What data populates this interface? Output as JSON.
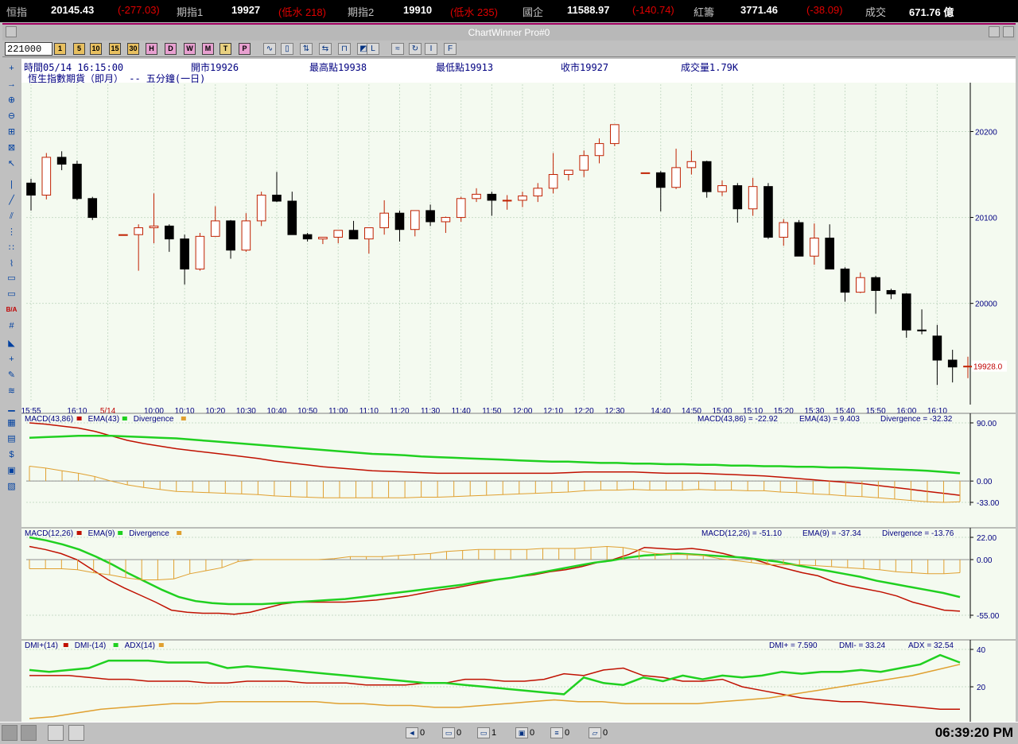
{
  "ticker": [
    {
      "label": "恒指",
      "value": "20145.43",
      "change": "(-277.03)"
    },
    {
      "label": "期指1",
      "value": "19927",
      "change": "(低水 218)"
    },
    {
      "label": "期指2",
      "value": "19910",
      "change": "(低水 235)"
    },
    {
      "label": "國企",
      "value": "11588.97",
      "change": "(-140.74)"
    },
    {
      "label": "紅籌",
      "value": "3771.46",
      "change": "(-38.09)"
    },
    {
      "label": "成交",
      "value": "671.76 億",
      "change": ""
    }
  ],
  "window": {
    "title": "ChartWinner Pro#0"
  },
  "toolbar": {
    "code": "221000",
    "period_buttons": [
      "1",
      "5",
      "10",
      "15",
      "30",
      "H",
      "D",
      "W",
      "M",
      "T",
      "P"
    ],
    "period_colors": [
      "#e8c060",
      "#e8c060",
      "#e8c060",
      "#e8c060",
      "#e8c060",
      "#e8a0d0",
      "#e8a0d0",
      "#e8a0d0",
      "#e8a0d0",
      "#e8d080",
      "#e8a0d0"
    ],
    "tool_icons": [
      "line-chart-icon",
      "candlestick-icon",
      "bar-chart-icon",
      "compare-icon",
      "chart-type-icon",
      "chart-type2-icon",
      "label-icon",
      "overlay-icon",
      "refresh-icon",
      "info-icon",
      "function-icon"
    ],
    "tool_glyphs": [
      "∿",
      "▯",
      "⇅",
      "⇆",
      "⊓",
      "◩",
      "L",
      "≈",
      "↻",
      "I",
      "F"
    ]
  },
  "left_tools": [
    "crosshair-icon",
    "arrow-icon",
    "zoom-in-icon",
    "zoom-out-icon",
    "zoom-area-icon",
    "zoom-fit-icon",
    "pointer-icon",
    "vertical-line-icon",
    "trend-line-icon",
    "parallel-line-icon",
    "fibonacci-icon",
    "pattern-icon",
    "speed-line-icon",
    "box-icon",
    "box2-icon",
    "bid-ask-icon",
    "grid-icon",
    "fill-icon",
    "plus-icon",
    "pen-icon",
    "wave-icon",
    "text-icon",
    "calc-icon",
    "note-icon",
    "scroll-icon",
    "layout-icon",
    "clipboard-icon"
  ],
  "left_glyphs": [
    "+",
    "→",
    "⊕",
    "⊖",
    "⊞",
    "⊠",
    "↖",
    "|",
    "╱",
    "⫽",
    "⋮",
    "∷",
    "⌇",
    "▭",
    "▭",
    "B/A",
    "#",
    "◣",
    "+",
    "✎",
    "≋",
    "▁",
    "▦",
    "▤",
    "$",
    "▣",
    "▧"
  ],
  "info": {
    "time": "時間05/14 16:15:00",
    "open": "開市19926",
    "high": "最高點19938",
    "low": "最低點19913",
    "close": "收市19927",
    "volume": "成交量1.79K",
    "subtitle": "恆生指數期貨（即月） -- 五分鐘(一日)"
  },
  "colors": {
    "up": "#c02000",
    "down": "#000000",
    "red": "#c01000",
    "green": "#20d020",
    "orange": "#e0a030",
    "grid": "#c8dcc8",
    "axis": "#000080"
  },
  "chart_data": [
    {
      "type": "candlestick",
      "title": "恆生指數期貨（即月） -- 五分鐘(一日)",
      "ylim": [
        19885,
        20255
      ],
      "y_ticks": [
        20000,
        20100,
        20200
      ],
      "last_price_label": "19928.0",
      "x_tick_labels": [
        "15:55",
        "16:10",
        "5/14",
        "10:00",
        "10:10",
        "10:20",
        "10:30",
        "10:40",
        "10:50",
        "11:00",
        "11:10",
        "11:20",
        "11:30",
        "11:40",
        "11:50",
        "12:00",
        "12:10",
        "12:20",
        "12:30",
        "14:40",
        "14:50",
        "15:00",
        "15:10",
        "15:20",
        "15:30",
        "15:40",
        "15:50",
        "16:00",
        "16:10"
      ],
      "x_tick_index": [
        0,
        3,
        5,
        8,
        10,
        12,
        14,
        16,
        18,
        20,
        22,
        24,
        26,
        28,
        30,
        32,
        34,
        36,
        38,
        41,
        43,
        45,
        47,
        49,
        51,
        53,
        55,
        57,
        59
      ],
      "candles": [
        [
          20140,
          20145,
          20108,
          20126
        ],
        [
          20126,
          20175,
          20121,
          20170
        ],
        [
          20170,
          20177,
          20155,
          20162
        ],
        [
          20162,
          20166,
          20120,
          20122
        ],
        [
          20122,
          20124,
          20097,
          20100
        ],
        [
          null,
          null,
          null,
          null
        ],
        [
          20080,
          20080,
          20080,
          20080
        ],
        [
          20080,
          20092,
          20038,
          20088
        ],
        [
          20088,
          20128,
          20070,
          20090
        ],
        [
          20090,
          20092,
          20060,
          20075
        ],
        [
          20075,
          20080,
          20022,
          20040
        ],
        [
          20040,
          20082,
          20038,
          20078
        ],
        [
          20078,
          20113,
          20078,
          20096
        ],
        [
          20096,
          20097,
          20052,
          20062
        ],
        [
          20062,
          20105,
          20060,
          20096
        ],
        [
          20096,
          20130,
          20090,
          20126
        ],
        [
          20126,
          20153,
          20118,
          20119
        ],
        [
          20119,
          20130,
          20092,
          20080
        ],
        [
          20080,
          20082,
          20072,
          20075
        ],
        [
          20075,
          20076,
          20069,
          20077
        ],
        [
          20077,
          20085,
          20070,
          20085
        ],
        [
          20085,
          20096,
          20075,
          20075
        ],
        [
          20075,
          20078,
          20058,
          20088
        ],
        [
          20088,
          20120,
          20080,
          20105
        ],
        [
          20105,
          20108,
          20072,
          20086
        ],
        [
          20086,
          20108,
          20078,
          20108
        ],
        [
          20108,
          20115,
          20090,
          20095
        ],
        [
          20095,
          20101,
          20082,
          20100
        ],
        [
          20100,
          20124,
          20095,
          20122
        ],
        [
          20122,
          20134,
          20118,
          20127
        ],
        [
          20127,
          20130,
          20102,
          20120
        ],
        [
          20120,
          20126,
          20109,
          20120
        ],
        [
          20120,
          20130,
          20112,
          20125
        ],
        [
          20125,
          20140,
          20118,
          20134
        ],
        [
          20134,
          20175,
          20128,
          20150
        ],
        [
          20150,
          20154,
          20143,
          20155
        ],
        [
          20155,
          20178,
          20147,
          20172
        ],
        [
          20172,
          20192,
          20163,
          20186
        ],
        [
          20186,
          20208,
          20183,
          20208
        ],
        [
          null,
          null,
          null,
          null
        ],
        [
          20152,
          20152,
          20152,
          20152
        ],
        [
          20152,
          20154,
          20107,
          20135
        ],
        [
          20135,
          20180,
          20133,
          20158
        ],
        [
          20158,
          20178,
          20150,
          20165
        ],
        [
          20165,
          20166,
          20123,
          20130
        ],
        [
          20130,
          20143,
          20125,
          20137
        ],
        [
          20137,
          20140,
          20094,
          20110
        ],
        [
          20110,
          20146,
          20102,
          20136
        ],
        [
          20136,
          20140,
          20075,
          20077
        ],
        [
          20077,
          20098,
          20067,
          20094
        ],
        [
          20094,
          20097,
          20055,
          20055
        ],
        [
          20055,
          20093,
          20045,
          20076
        ],
        [
          20076,
          20092,
          20040,
          20040
        ],
        [
          20040,
          20042,
          20002,
          20013
        ],
        [
          20013,
          20036,
          20012,
          20030
        ],
        [
          20030,
          20032,
          19988,
          20015
        ],
        [
          20015,
          20017,
          20005,
          20011
        ],
        [
          20011,
          20012,
          19960,
          19969
        ],
        [
          19969,
          19993,
          19964,
          19968
        ],
        [
          19962,
          19975,
          19905,
          19934
        ],
        [
          19934,
          19946,
          19908,
          19926
        ],
        [
          19926,
          19938,
          19913,
          19927
        ]
      ]
    },
    {
      "type": "line",
      "title": "MACD(43,86)",
      "legend": [
        "MACD(43,86)",
        "EMA(43)",
        "Divergence"
      ],
      "readout": {
        "macd": "MACD(43,86) = -22.92",
        "ema": "EMA(43) = 9.403",
        "div": "Divergence = -32.32"
      },
      "ylim": [
        -33,
        90
      ],
      "y_ticks": [
        "90.00",
        "0.00",
        "-33.00"
      ],
      "series": [
        {
          "name": "MACD(43,86)",
          "values": [
            90,
            88,
            85,
            82,
            77,
            70,
            63,
            58,
            54,
            50,
            47,
            44,
            41,
            38,
            35,
            31,
            28,
            25,
            22,
            20,
            18,
            16,
            15,
            14,
            13,
            12,
            12,
            12,
            12,
            12,
            12,
            12,
            12,
            13,
            14,
            14,
            14,
            14,
            13,
            12,
            12,
            12,
            11,
            10,
            9,
            8,
            6,
            4,
            2,
            0,
            -2,
            -4,
            -7,
            -10,
            -13,
            -16,
            -19,
            -22
          ]
        },
        {
          "name": "EMA(43)",
          "values": [
            67,
            68,
            69,
            70,
            70,
            70,
            69,
            68,
            67,
            66,
            64,
            62,
            60,
            58,
            56,
            54,
            52,
            50,
            48,
            46,
            44,
            42,
            41,
            40,
            38,
            37,
            36,
            35,
            34,
            33,
            32,
            31,
            30,
            30,
            29,
            28,
            28,
            27,
            27,
            26,
            26,
            25,
            25,
            24,
            24,
            23,
            23,
            22,
            22,
            21,
            21,
            20,
            19,
            18,
            17,
            16,
            14,
            12
          ]
        },
        {
          "name": "Divergence",
          "values": [
            23,
            20,
            16,
            12,
            7,
            0,
            -6,
            -10,
            -13,
            -16,
            -17,
            -18,
            -19,
            -20,
            -21,
            -23,
            -24,
            -25,
            -26,
            -26,
            -26,
            -26,
            -26,
            -26,
            -25,
            -25,
            -24,
            -23,
            -22,
            -21,
            -20,
            -19,
            -18,
            -17,
            -15,
            -14,
            -14,
            -13,
            -14,
            -14,
            -14,
            -13,
            -14,
            -14,
            -15,
            -15,
            -17,
            -18,
            -20,
            -21,
            -23,
            -24,
            -26,
            -28,
            -30,
            -32,
            -33,
            -32
          ]
        }
      ]
    },
    {
      "type": "line",
      "title": "MACD(12,26)",
      "legend": [
        "MACD(12,26)",
        "EMA(9)",
        "Divergence"
      ],
      "readout": {
        "macd": "MACD(12,26) = -51.10",
        "ema": "EMA(9) = -37.34",
        "div": "Divergence = -13.76"
      },
      "ylim": [
        -55,
        22
      ],
      "y_ticks": [
        "22.00",
        "0.00",
        "-55.00"
      ],
      "series": [
        {
          "name": "MACD(12,26)",
          "values": [
            13,
            10,
            6,
            0,
            -10,
            -20,
            -28,
            -35,
            -42,
            -50,
            -52,
            -53,
            -53,
            -54,
            -52,
            -48,
            -44,
            -42,
            -42,
            -42,
            -42,
            -41,
            -40,
            -38,
            -36,
            -33,
            -30,
            -28,
            -25,
            -22,
            -19,
            -17,
            -15,
            -12,
            -10,
            -7,
            -3,
            0,
            5,
            12,
            11,
            10,
            11,
            9,
            6,
            2,
            0,
            -5,
            -9,
            -13,
            -16,
            -22,
            -26,
            -29,
            -32,
            -36,
            -42,
            -46,
            -50,
            -51
          ]
        },
        {
          "name": "EMA(9)",
          "values": [
            22,
            19,
            15,
            10,
            3,
            -5,
            -14,
            -22,
            -30,
            -37,
            -41,
            -43,
            -44,
            -44,
            -44,
            -43,
            -42,
            -41,
            -40,
            -39,
            -37,
            -35,
            -33,
            -31,
            -29,
            -27,
            -25,
            -22,
            -20,
            -18,
            -15,
            -12,
            -9,
            -6,
            -3,
            -1,
            2,
            4,
            5,
            6,
            5,
            4,
            3,
            2,
            0,
            -2,
            -5,
            -8,
            -11,
            -14,
            -17,
            -21,
            -24,
            -27,
            -30,
            -33,
            -37
          ]
        },
        {
          "name": "Divergence",
          "values": [
            -9,
            -9,
            -9,
            -10,
            -13,
            -15,
            -18,
            -20,
            -20,
            -19,
            -14,
            -11,
            -8,
            -2,
            0,
            0,
            0,
            0,
            0,
            1,
            3,
            3,
            3,
            4,
            5,
            6,
            8,
            9,
            10,
            10,
            10,
            10,
            11,
            11,
            11,
            12,
            13,
            12,
            9,
            6,
            5,
            5,
            4,
            1,
            -1,
            -3,
            -5,
            -5,
            -5,
            -6,
            -7,
            -8,
            -9,
            -10,
            -12,
            -13,
            -14,
            -14,
            -13
          ]
        }
      ]
    },
    {
      "type": "line",
      "title": "DMI(14)",
      "legend": [
        "DMI+(14)",
        "DMI-(14)",
        "ADX(14)"
      ],
      "readout": {
        "dip": "DMI+ = 7.590",
        "dim": "DMI- = 33.24",
        "adx": "ADX = 32.54"
      },
      "ylim": [
        3,
        40
      ],
      "y_ticks": [
        "40",
        "20"
      ],
      "series": [
        {
          "name": "DMI+(14)",
          "values": [
            26,
            26,
            26,
            25,
            24,
            24,
            23,
            23,
            23,
            22,
            22,
            23,
            23,
            23,
            22,
            22,
            22,
            21,
            21,
            21,
            22,
            22,
            24,
            24,
            23,
            23,
            24,
            27,
            26,
            29,
            30,
            26,
            25,
            23,
            23,
            24,
            20,
            18,
            16,
            14,
            13,
            12,
            12,
            11,
            10,
            9,
            8,
            8
          ]
        },
        {
          "name": "DMI-(14)",
          "values": [
            29,
            28,
            29,
            30,
            34,
            34,
            34,
            33,
            33,
            33,
            30,
            31,
            30,
            29,
            28,
            27,
            26,
            25,
            24,
            23,
            22,
            22,
            21,
            20,
            19,
            18,
            17,
            16,
            25,
            22,
            21,
            25,
            23,
            26,
            24,
            26,
            25,
            26,
            28,
            27,
            28,
            28,
            29,
            28,
            30,
            32,
            37,
            33
          ]
        },
        {
          "name": "ADX(14)",
          "values": [
            3,
            4,
            6,
            8,
            9,
            10,
            11,
            11,
            12,
            12,
            12,
            12,
            12,
            11,
            11,
            10,
            10,
            9,
            9,
            10,
            11,
            12,
            13,
            12,
            12,
            11,
            11,
            11,
            11,
            12,
            13,
            14,
            16,
            18,
            20,
            22,
            24,
            26,
            29,
            32
          ]
        }
      ]
    }
  ],
  "status": {
    "items": [
      {
        "icon": "speaker-icon",
        "glyph": "◄",
        "value": "0"
      },
      {
        "icon": "window-icon",
        "glyph": "▭",
        "value": "0"
      },
      {
        "icon": "window-alert-icon",
        "glyph": "▭",
        "value": "1"
      },
      {
        "icon": "news-icon",
        "glyph": "▣",
        "value": "0"
      },
      {
        "icon": "list-icon",
        "glyph": "≡",
        "value": "0"
      },
      {
        "icon": "folder-icon",
        "glyph": "▱",
        "value": "0"
      }
    ],
    "clock": "06:39:20 PM"
  }
}
